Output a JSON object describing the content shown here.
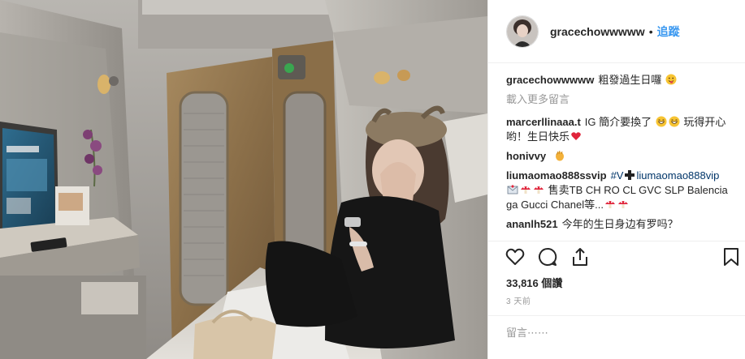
{
  "post": {
    "username": "gracechowwwww",
    "follow_label": "追蹤",
    "separator": "•",
    "caption": "粗發過生日囉",
    "load_more": "載入更多留言",
    "likes_text": "33,816 個讚",
    "time_ago": "3 天前",
    "comment_placeholder": "留言⋯⋯"
  },
  "comments": [
    {
      "user": "marcerllinaaa.t",
      "text": "IG 簡介要換了",
      "text2": "玩得开心哟！生日快乐"
    },
    {
      "user": "honivvy"
    },
    {
      "user": "liumaomao888ssvip",
      "tag1": "#V",
      "tag2": "liumaomao888vip",
      "text": "售卖TB CH RO CL GVC SLP Balenciaga Gucci Chanel等..."
    },
    {
      "user": "ananlh521",
      "text": "今年的生日身边有罗吗？"
    }
  ],
  "icons": {
    "like": "heart-icon",
    "comment": "comment-icon",
    "share": "share-icon",
    "save": "bookmark-icon"
  },
  "colors": {
    "link": "#3897f0",
    "text": "#262626",
    "muted": "#999999",
    "border": "#efefef"
  }
}
